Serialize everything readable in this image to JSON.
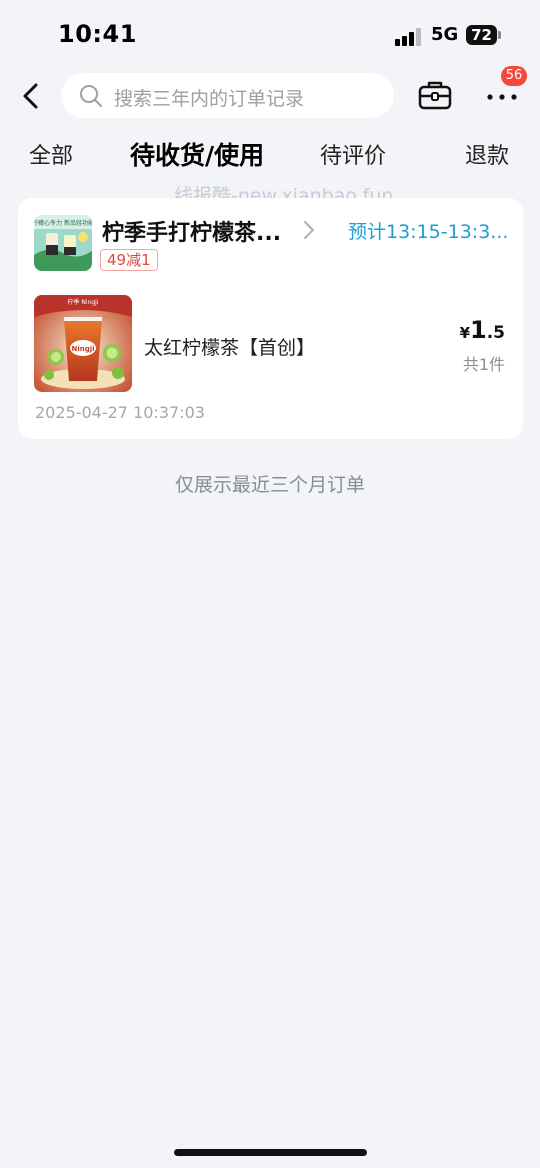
{
  "status_bar": {
    "time": "10:41",
    "network": "5G",
    "battery": "72"
  },
  "header": {
    "search_placeholder": "搜索三年内的订单记录",
    "badge_count": "56",
    "icons": {
      "back": "back-chevron-icon",
      "search": "search-icon",
      "toolbox": "toolbox-icon",
      "more": "more-dots-icon"
    }
  },
  "tabs": [
    {
      "label": "全部",
      "active": false
    },
    {
      "label": "待收货/使用",
      "active": true
    },
    {
      "label": "待评价",
      "active": false
    },
    {
      "label": "退款",
      "active": false
    }
  ],
  "watermark": "线报酷-new.xianbao.fun",
  "order": {
    "store_name": "柠季手打柠檬茶...",
    "promo_tag": "49减1",
    "eta": "预计13:15-13:3...",
    "product_name": "太红柠檬茶【首创】",
    "price_symbol": "¥",
    "price_integer": "1",
    "price_decimal": ".5",
    "quantity": "共1件",
    "order_time": "2025-04-27 10:37:03",
    "logo_banner_text": "柠檬心冬力 新品轻功能",
    "product_brand_text": "柠季 Ningji"
  },
  "footer_note": "仅展示最近三个月订单",
  "colors": {
    "background": "#f2f4f7",
    "accent_blue": "#1a9fd8",
    "badge_red": "#f5473b",
    "promo_red": "#e4473a"
  }
}
